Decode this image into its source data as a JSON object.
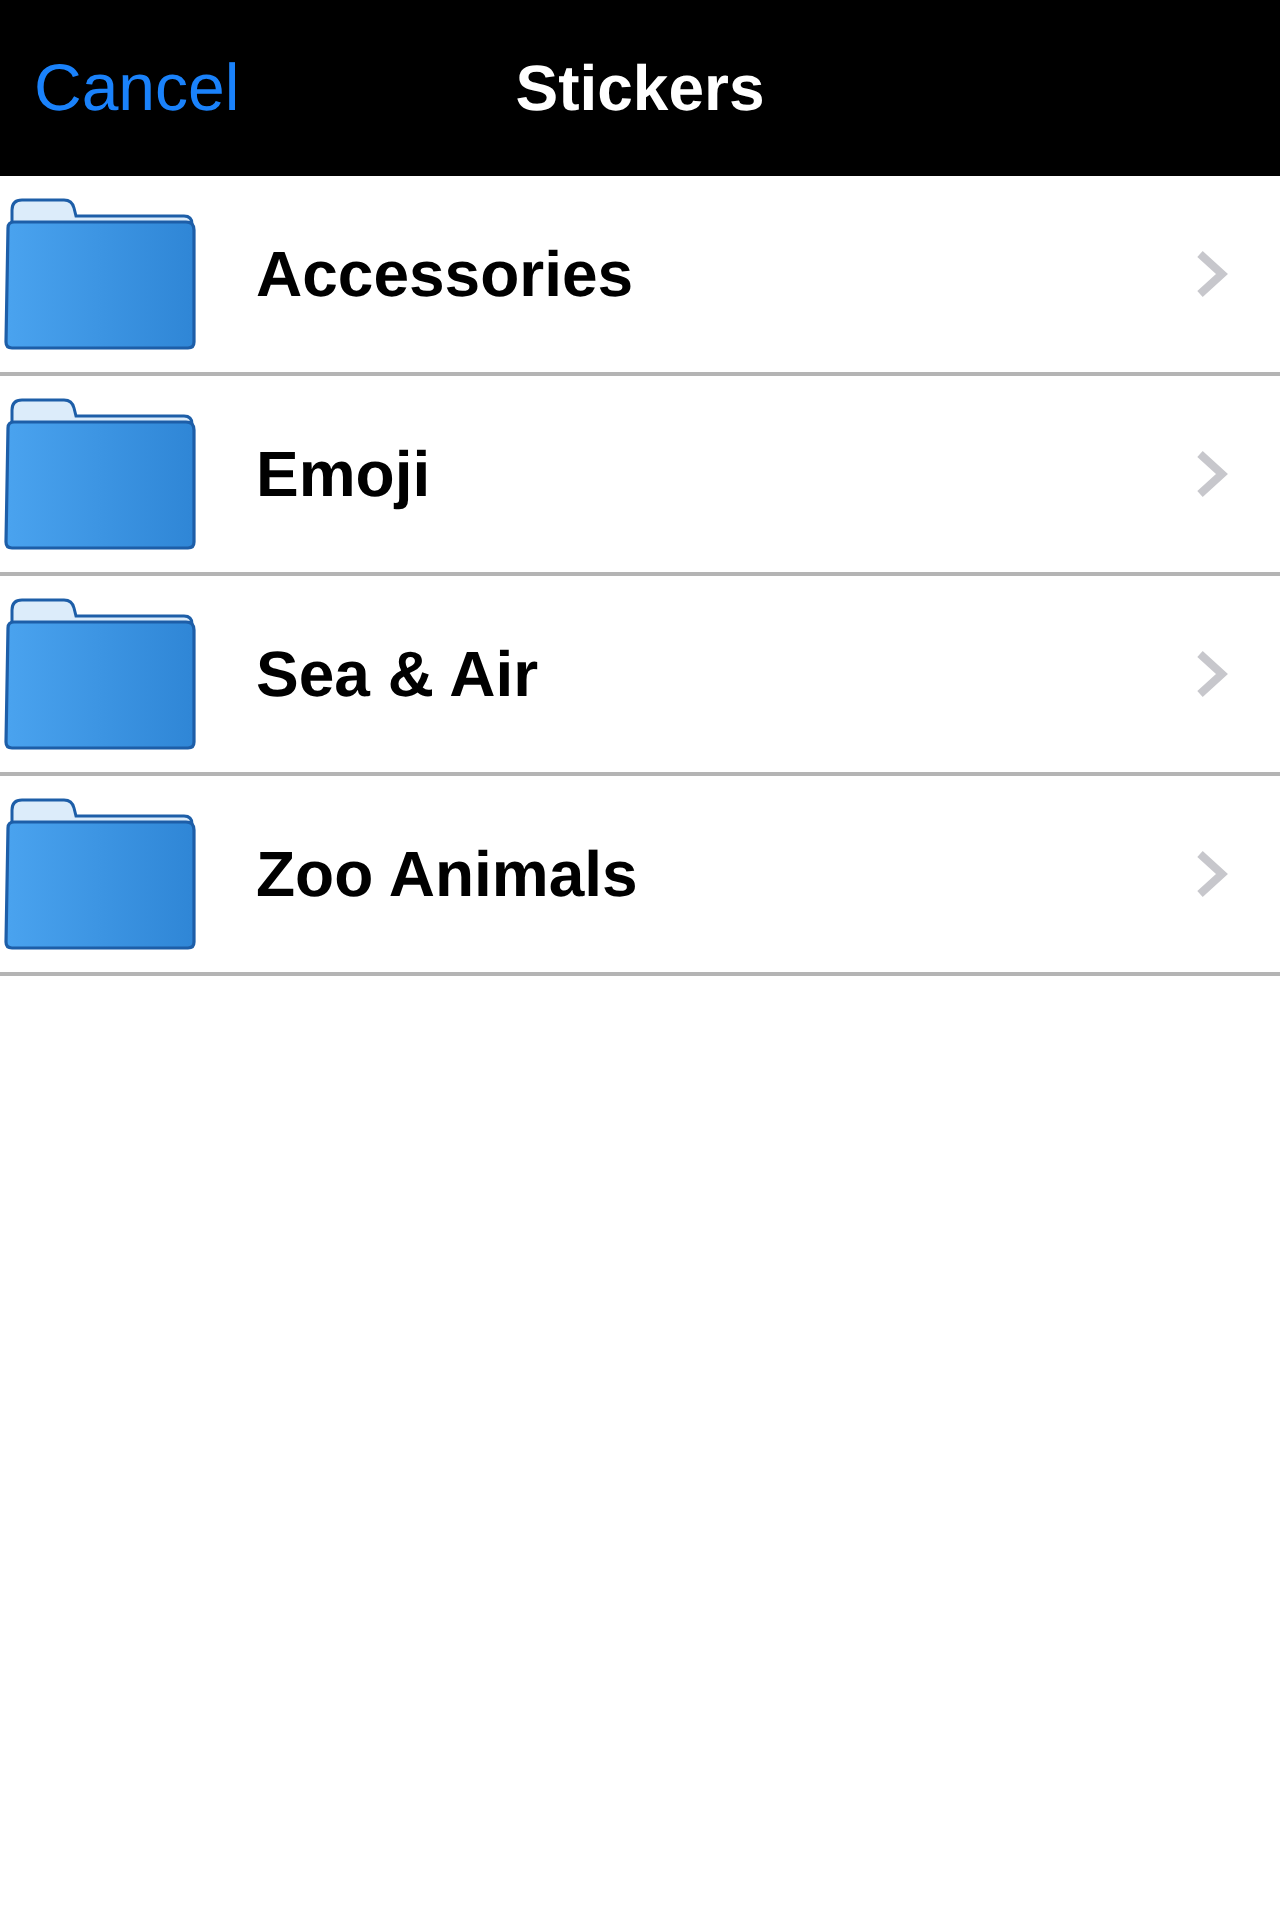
{
  "nav_bar": {
    "cancel_button": "Cancel",
    "title": "Stickers"
  },
  "folders": [
    {
      "name": "Accessories"
    },
    {
      "name": "Emoji"
    },
    {
      "name": "Sea & Air"
    },
    {
      "name": "Zoo Animals"
    }
  ]
}
